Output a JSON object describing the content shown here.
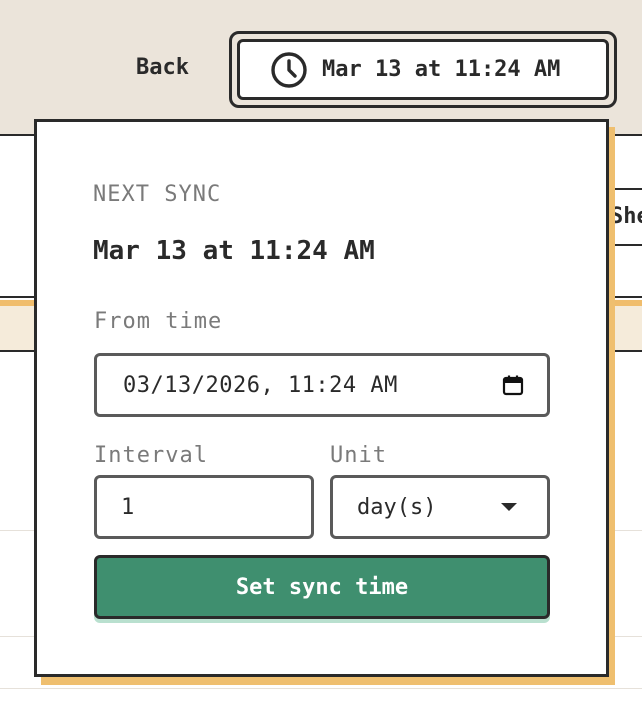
{
  "header": {
    "back_label": "Back",
    "sync_button_label": "Mar 13 at 11:24 AM",
    "sync_icon": "clock-icon"
  },
  "background": {
    "partial_tab_label": "She"
  },
  "popover": {
    "eyebrow": "NEXT SYNC",
    "next_sync_time": "Mar 13 at 11:24 AM",
    "from_time_label": "From time",
    "from_time_value": "03/13/2026, 11:24 AM",
    "calendar_icon": "calendar-icon",
    "interval_label": "Interval",
    "interval_value": "1",
    "unit_label": "Unit",
    "unit_value": "day(s)",
    "submit_label": "Set sync time"
  },
  "colors": {
    "topbar_bg": "#ebe4da",
    "accent_shadow": "#efbf6f",
    "primary_button": "#3f8f6f",
    "border": "#2a2a2a",
    "muted_text": "#7a7a7a"
  }
}
